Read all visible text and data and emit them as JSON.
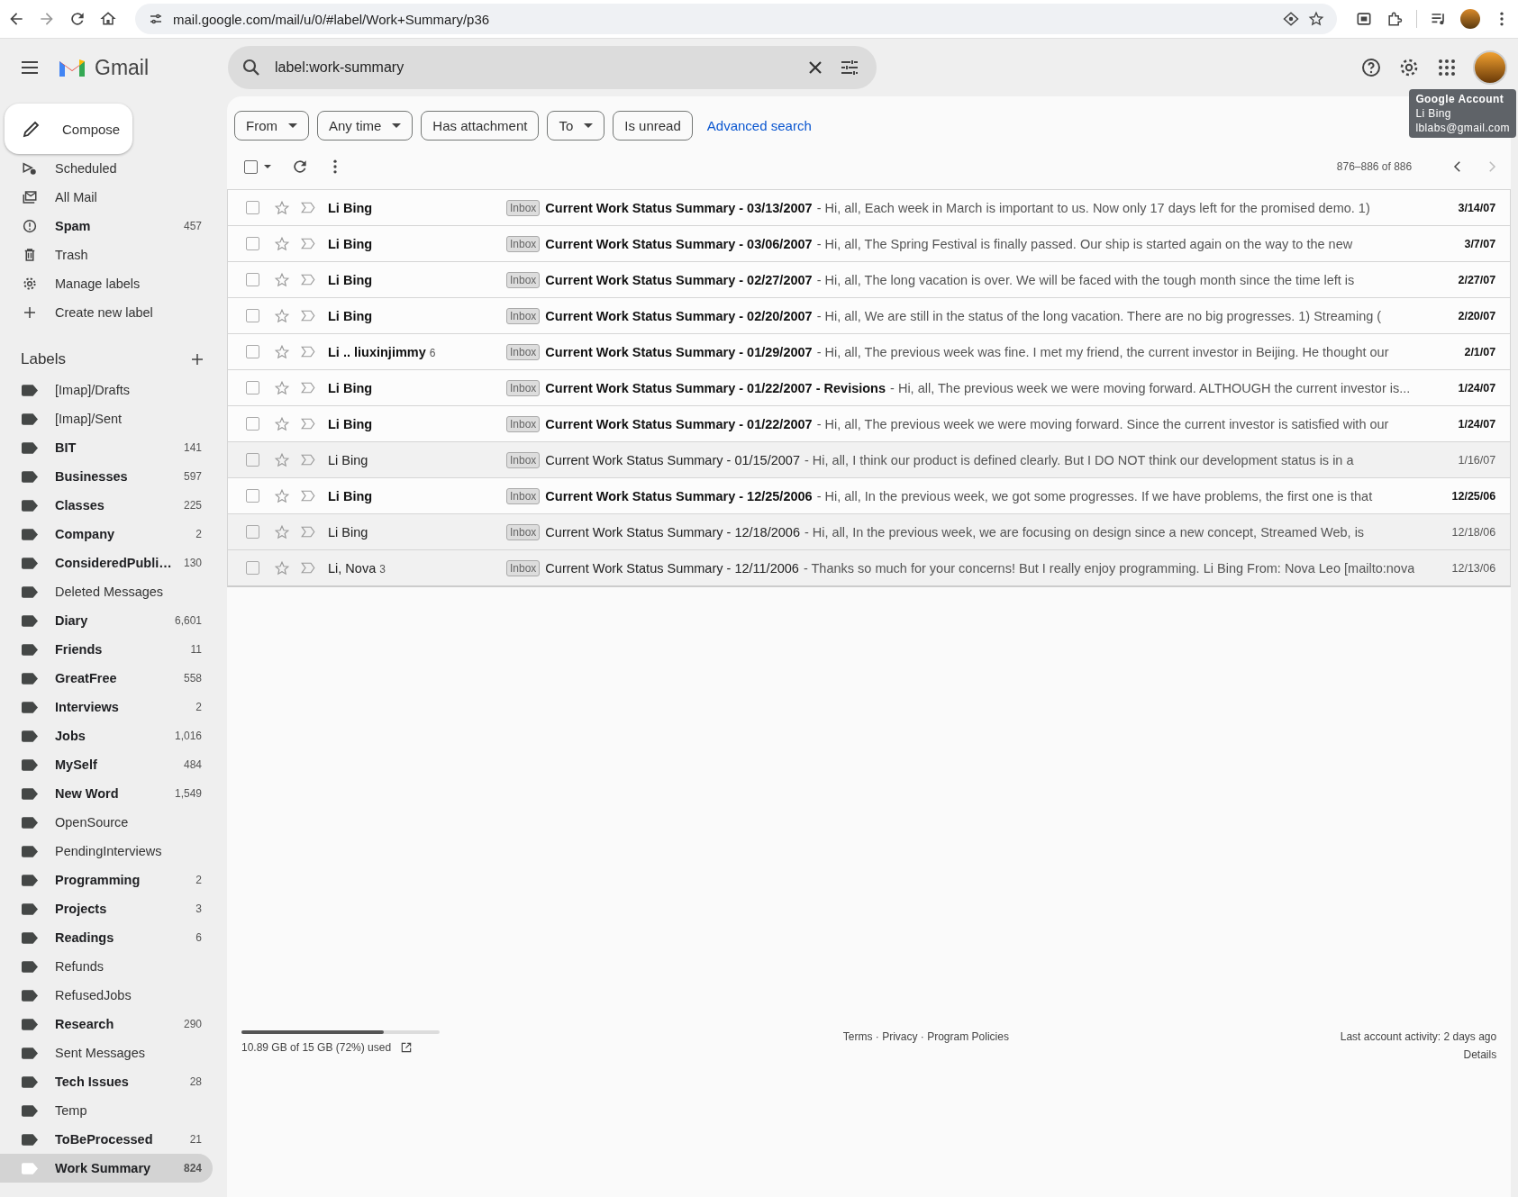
{
  "browser": {
    "url": "mail.google.com/mail/u/0/#label/Work+Summary/p36"
  },
  "header": {
    "app_name": "Gmail",
    "search_query": "label:work-summary"
  },
  "account_tooltip": {
    "title": "Google Account",
    "name": "Li Bing",
    "email": "lblabs@gmail.com"
  },
  "compose": {
    "label": "Compose"
  },
  "nav_items": [
    {
      "label": "Scheduled",
      "unread": false
    },
    {
      "label": "All Mail",
      "unread": false
    },
    {
      "label": "Spam",
      "count": "457",
      "unread": true
    },
    {
      "label": "Trash",
      "unread": false
    },
    {
      "label": "Manage labels",
      "unread": false
    },
    {
      "label": "Create new label",
      "unread": false
    }
  ],
  "labels_heading": "Labels",
  "labels": [
    {
      "name": "[Imap]/Drafts",
      "unread": false,
      "selected": false,
      "color": "#444746"
    },
    {
      "name": "[Imap]/Sent",
      "unread": false,
      "selected": false,
      "color": "#444746"
    },
    {
      "name": "BIT",
      "count": "141",
      "unread": true,
      "selected": false,
      "color": "#444746"
    },
    {
      "name": "Businesses",
      "count": "597",
      "unread": true,
      "selected": false,
      "color": "#444746"
    },
    {
      "name": "Classes",
      "count": "225",
      "unread": true,
      "selected": false,
      "color": "#444746"
    },
    {
      "name": "Company",
      "count": "2",
      "unread": true,
      "selected": false,
      "color": "#444746"
    },
    {
      "name": "ConsideredPubli…",
      "count": "130",
      "unread": true,
      "selected": false,
      "color": "#444746"
    },
    {
      "name": "Deleted Messages",
      "unread": false,
      "selected": false,
      "color": "#444746"
    },
    {
      "name": "Diary",
      "count": "6,601",
      "unread": true,
      "selected": false,
      "color": "#444746"
    },
    {
      "name": "Friends",
      "count": "11",
      "unread": true,
      "selected": false,
      "color": "#444746"
    },
    {
      "name": "GreatFree",
      "count": "558",
      "unread": true,
      "selected": false,
      "color": "#444746"
    },
    {
      "name": "Interviews",
      "count": "2",
      "unread": true,
      "selected": false,
      "color": "#444746"
    },
    {
      "name": "Jobs",
      "count": "1,016",
      "unread": true,
      "selected": false,
      "color": "#444746"
    },
    {
      "name": "MySelf",
      "count": "484",
      "unread": true,
      "selected": false,
      "color": "#444746"
    },
    {
      "name": "New Word",
      "count": "1,549",
      "unread": true,
      "selected": false,
      "color": "#444746"
    },
    {
      "name": "OpenSource",
      "unread": false,
      "selected": false,
      "color": "#444746"
    },
    {
      "name": "PendingInterviews",
      "unread": false,
      "selected": false,
      "color": "#444746"
    },
    {
      "name": "Programming",
      "count": "2",
      "unread": true,
      "selected": false,
      "color": "#444746"
    },
    {
      "name": "Projects",
      "count": "3",
      "unread": true,
      "selected": false,
      "color": "#444746"
    },
    {
      "name": "Readings",
      "count": "6",
      "unread": true,
      "selected": false,
      "color": "#444746"
    },
    {
      "name": "Refunds",
      "unread": false,
      "selected": false,
      "color": "#444746"
    },
    {
      "name": "RefusedJobs",
      "unread": false,
      "selected": false,
      "color": "#444746"
    },
    {
      "name": "Research",
      "count": "290",
      "unread": true,
      "selected": false,
      "color": "#444746"
    },
    {
      "name": "Sent Messages",
      "unread": false,
      "selected": false,
      "color": "#444746"
    },
    {
      "name": "Tech Issues",
      "count": "28",
      "unread": true,
      "selected": false,
      "color": "#444746"
    },
    {
      "name": "Temp",
      "unread": false,
      "selected": false,
      "color": "#444746"
    },
    {
      "name": "ToBeProcessed",
      "count": "21",
      "unread": true,
      "selected": false,
      "color": "#444746"
    },
    {
      "name": "Work Summary",
      "count": "824",
      "unread": true,
      "selected": true,
      "color": "#ffffff"
    }
  ],
  "filters": [
    {
      "label": "From",
      "dropdown": true
    },
    {
      "label": "Any time",
      "dropdown": true
    },
    {
      "label": "Has attachment",
      "dropdown": false
    },
    {
      "label": "To",
      "dropdown": true
    },
    {
      "label": "Is unread",
      "dropdown": false
    }
  ],
  "advanced_search": "Advanced search",
  "select_all": {
    "checked": false
  },
  "pagination": {
    "range": "876–886 of 886",
    "prev_disabled": false,
    "next_disabled": true
  },
  "emails": [
    {
      "sender": "Li Bing",
      "unread": true,
      "checked": false,
      "starred": false,
      "label": "Inbox",
      "subject": "Current Work Status Summary - 03/13/2007",
      "snippet": "- Hi, all, Each week in March is important to us. Now only 17 days left for the promised demo. 1)",
      "date": "3/14/07"
    },
    {
      "sender": "Li Bing",
      "unread": true,
      "checked": false,
      "starred": false,
      "label": "Inbox",
      "subject": "Current Work Status Summary - 03/06/2007",
      "snippet": "- Hi, all, The Spring Festival is finally passed. Our ship is started again on the way to the new",
      "date": "3/7/07"
    },
    {
      "sender": "Li Bing",
      "unread": true,
      "checked": false,
      "starred": false,
      "label": "Inbox",
      "subject": "Current Work Status Summary - 02/27/2007",
      "snippet": "- Hi, all, The long vacation is over. We will be faced with the tough month since the time left is",
      "date": "2/27/07"
    },
    {
      "sender": "Li Bing",
      "unread": true,
      "checked": false,
      "starred": false,
      "label": "Inbox",
      "subject": "Current Work Status Summary - 02/20/2007",
      "snippet": "- Hi, all, We are still in the status of the long vacation. There are no big progresses. 1) Streaming (",
      "date": "2/20/07"
    },
    {
      "sender": "Li .. liuxinjimmy",
      "count": "6",
      "unread": true,
      "checked": false,
      "starred": false,
      "label": "Inbox",
      "subject": "Current Work Status Summary - 01/29/2007",
      "snippet": "- Hi, all, The previous week was fine. I met my friend, the current investor in Beijing. He thought our",
      "date": "2/1/07"
    },
    {
      "sender": "Li Bing",
      "unread": true,
      "checked": false,
      "starred": false,
      "label": "Inbox",
      "subject": "Current Work Status Summary - 01/22/2007 - Revisions",
      "snippet": "- Hi, all, The previous week we were moving forward. ALTHOUGH the current investor is...",
      "date": "1/24/07"
    },
    {
      "sender": "Li Bing",
      "unread": true,
      "checked": false,
      "starred": false,
      "label": "Inbox",
      "subject": "Current Work Status Summary - 01/22/2007",
      "snippet": "- Hi, all, The previous week we were moving forward. Since the current investor is satisfied with our",
      "date": "1/24/07"
    },
    {
      "sender": "Li Bing",
      "unread": false,
      "checked": false,
      "starred": false,
      "label": "Inbox",
      "subject": "Current Work Status Summary - 01/15/2007",
      "snippet": "- Hi, all, I think our product is defined clearly. But I DO NOT think our development status is in a",
      "date": "1/16/07"
    },
    {
      "sender": "Li Bing",
      "unread": true,
      "checked": false,
      "starred": false,
      "label": "Inbox",
      "subject": "Current Work Status Summary - 12/25/2006",
      "snippet": "- Hi, all, In the previous week, we got some progresses. If we have problems, the first one is that",
      "date": "12/25/06"
    },
    {
      "sender": "Li Bing",
      "unread": false,
      "checked": false,
      "starred": false,
      "label": "Inbox",
      "subject": "Current Work Status Summary - 12/18/2006",
      "snippet": "- Hi, all, In the previous week, we are focusing on design since a new concept, Streamed Web, is",
      "date": "12/18/06"
    },
    {
      "sender": "Li, Nova",
      "count": "3",
      "unread": false,
      "checked": false,
      "starred": false,
      "label": "Inbox",
      "subject": "Current Work Status Summary - 12/11/2006",
      "snippet": "- Thanks so much for your concerns! But I really enjoy programming. Li Bing From: Nova Leo [mailto:nova",
      "date": "12/13/06"
    }
  ],
  "footer": {
    "storage": {
      "level": 0.72,
      "text": "10.89 GB of 15 GB (72%) used"
    },
    "links": "Terms · Privacy · Program Policies",
    "activity": "Last account activity: 2 days ago",
    "details": "Details"
  }
}
